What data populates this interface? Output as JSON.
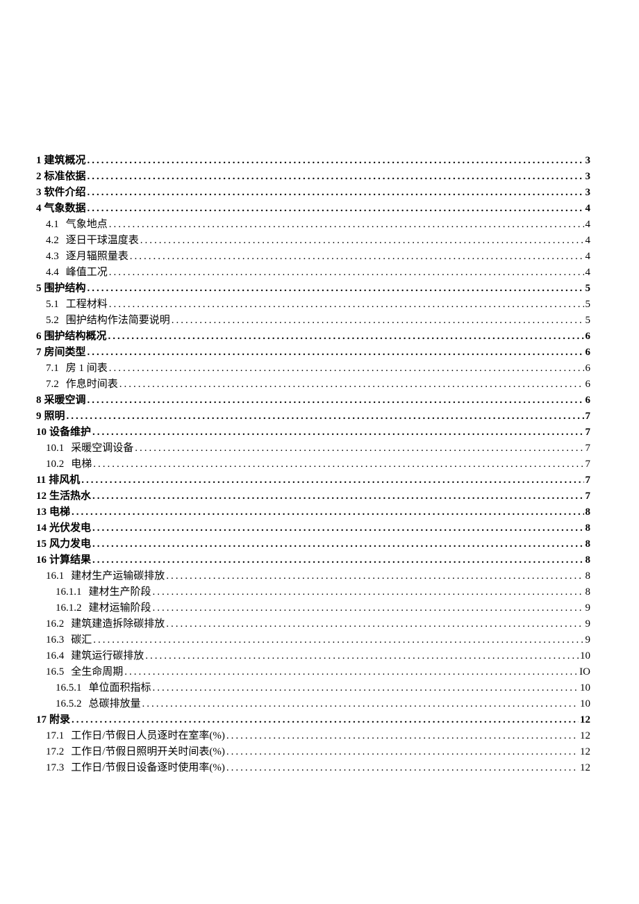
{
  "toc": [
    {
      "level": 1,
      "num": "1",
      "title": "建筑概况",
      "page": "3"
    },
    {
      "level": 1,
      "num": "2",
      "title": "标准依据",
      "page": "3"
    },
    {
      "level": 1,
      "num": "3",
      "title": "软件介绍",
      "page": "3"
    },
    {
      "level": 1,
      "num": "4",
      "title": "气象数据",
      "page": "4"
    },
    {
      "level": 2,
      "num": "4.1",
      "title": "气象地点",
      "page": "4"
    },
    {
      "level": 2,
      "num": "4.2",
      "title": "逐日干球温度表",
      "page": "4"
    },
    {
      "level": 2,
      "num": "4.3",
      "title": "逐月辐照量表",
      "page": "4"
    },
    {
      "level": 2,
      "num": "4.4",
      "title": "峰值工况",
      "page": "4"
    },
    {
      "level": 1,
      "num": "5",
      "title": "围护结构",
      "page": "5"
    },
    {
      "level": 2,
      "num": "5.1",
      "title": "工程材料",
      "page": "5"
    },
    {
      "level": 2,
      "num": "5.2",
      "title": "围护结构作法简要说明",
      "page": "5"
    },
    {
      "level": 1,
      "num": "6",
      "title": "围护结构概况",
      "page": "6"
    },
    {
      "level": 1,
      "num": "7",
      "title": "房间类型",
      "page": "6"
    },
    {
      "level": 2,
      "num": "7.1",
      "title": "房 1 间表",
      "page": "6"
    },
    {
      "level": 2,
      "num": "7.2",
      "title": "作息时间表",
      "page": "6"
    },
    {
      "level": 1,
      "num": "8",
      "title": "采暖空调",
      "page": "6"
    },
    {
      "level": 1,
      "num": "9",
      "title": "照明",
      "page": "7"
    },
    {
      "level": 1,
      "num": "10",
      "title": "设备维护",
      "page": "7"
    },
    {
      "level": 2,
      "num": "10.1",
      "title": "采暖空调设备",
      "page": "7"
    },
    {
      "level": 2,
      "num": "10.2",
      "title": "电梯",
      "page": "7"
    },
    {
      "level": 1,
      "num": "11",
      "title": "排风机",
      "page": "7"
    },
    {
      "level": 1,
      "num": "12",
      "title": "生活热水",
      "page": "7"
    },
    {
      "level": 1,
      "num": "13",
      "title": "电梯",
      "page": "8"
    },
    {
      "level": 1,
      "num": "14",
      "title": "光伏发电",
      "page": "8"
    },
    {
      "level": 1,
      "num": "15",
      "title": "风力发电",
      "page": "8"
    },
    {
      "level": 1,
      "num": "16",
      "title": "计算结果",
      "page": "8"
    },
    {
      "level": 2,
      "num": "16.1",
      "title": "建材生产运输碳排放",
      "page": "8"
    },
    {
      "level": 3,
      "num": "16.1.1",
      "title": "建材生产阶段",
      "page": "8"
    },
    {
      "level": 3,
      "num": "16.1.2",
      "title": "建材运输阶段",
      "page": "9"
    },
    {
      "level": 2,
      "num": "16.2",
      "title": "建筑建造拆除碳排放",
      "page": "9"
    },
    {
      "level": 2,
      "num": "16.3",
      "title": "碳汇",
      "page": "9"
    },
    {
      "level": 2,
      "num": "16.4",
      "title": "建筑运行碳排放",
      "page": "10"
    },
    {
      "level": 2,
      "num": "16.5",
      "title": "全生命周期",
      "page": "IO"
    },
    {
      "level": 3,
      "num": "16.5.1",
      "title": "单位面积指标",
      "page": "10"
    },
    {
      "level": 3,
      "num": "16.5.2",
      "title": "总碳排放量",
      "page": "10"
    },
    {
      "level": 1,
      "num": "17",
      "title": "附录",
      "page": "12"
    },
    {
      "level": 2,
      "num": "17.1",
      "title": "工作日/节假日人员逐时在室率(%)",
      "page": "12"
    },
    {
      "level": 2,
      "num": "17.2",
      "title": "工作日/节假日照明开关时间表(%)",
      "page": "12"
    },
    {
      "level": 2,
      "num": "17.3",
      "title": "工作日/节假日设备逐时使用率(%)",
      "page": "12"
    }
  ]
}
